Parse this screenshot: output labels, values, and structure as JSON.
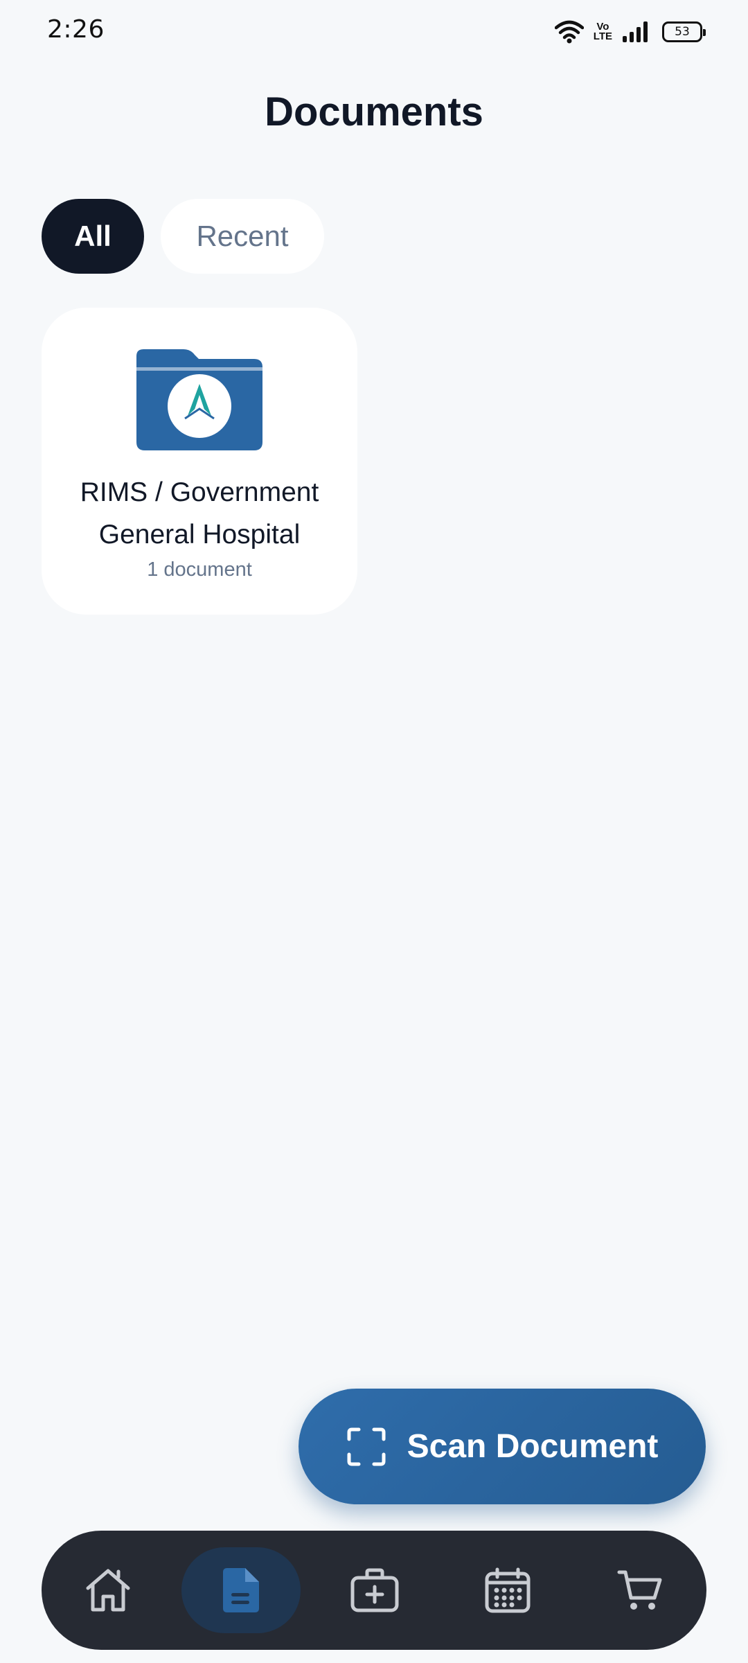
{
  "status_bar": {
    "time": "2:26",
    "network_badge": "Vo\nLTE",
    "battery_level": "53"
  },
  "page": {
    "title": "Documents"
  },
  "filters": {
    "active": "All",
    "items": [
      "All",
      "Recent"
    ]
  },
  "folders": [
    {
      "name": "RIMS / Government General Hospital",
      "count_label": "1 document",
      "icon": "folder-with-hospital-logo-icon"
    }
  ],
  "fab": {
    "label": "Scan Document",
    "icon": "scan-frame-icon"
  },
  "bottom_nav": {
    "active_index": 1,
    "items": [
      {
        "name": "home",
        "icon": "home-icon"
      },
      {
        "name": "documents",
        "icon": "document-icon"
      },
      {
        "name": "medical-kit",
        "icon": "medical-kit-icon"
      },
      {
        "name": "calendar",
        "icon": "calendar-icon"
      },
      {
        "name": "cart",
        "icon": "cart-icon"
      }
    ]
  },
  "colors": {
    "background": "#f6f8fa",
    "primary": "#2a67a4",
    "dark": "#111827",
    "nav_bg": "#262a33",
    "muted": "#64748b"
  }
}
